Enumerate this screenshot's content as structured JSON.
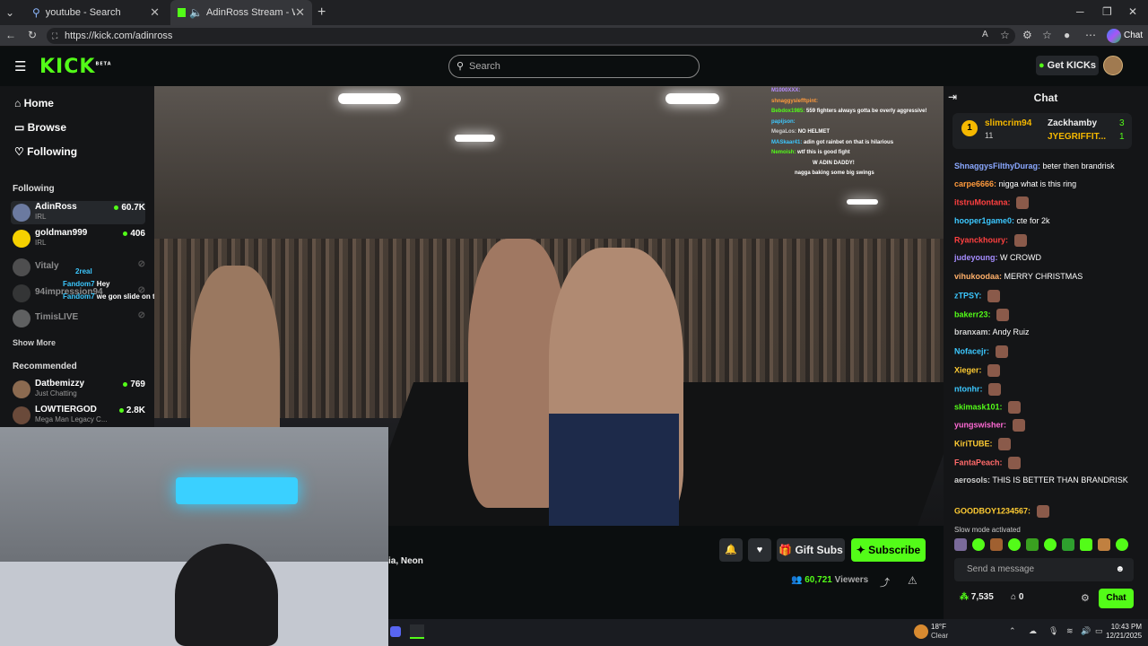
{
  "tabs": [
    {
      "title": "youtube - Search"
    },
    {
      "title": "AdinRoss Stream - Watch Live"
    }
  ],
  "address": {
    "url": "https://kick.com/adinross"
  },
  "browser": {
    "chat_label": "Chat"
  },
  "header": {
    "logo": "KICK",
    "beta": "BETA",
    "search_placeholder": "Search",
    "get_kicks": "Get KICKs"
  },
  "sidebar": {
    "nav": [
      {
        "label": "Home"
      },
      {
        "label": "Browse"
      },
      {
        "label": "Following"
      }
    ],
    "following_title": "Following",
    "following": [
      {
        "name": "AdinRoss",
        "category": "IRL",
        "viewers": "60.7K",
        "live": true
      },
      {
        "name": "goldman999",
        "category": "IRL",
        "viewers": "406",
        "live": true
      },
      {
        "name": "Vitaly",
        "category": "",
        "viewers": "",
        "live": false
      },
      {
        "name": "94impression94",
        "category": "",
        "viewers": "",
        "live": false
      },
      {
        "name": "TimisLIVE",
        "category": "",
        "viewers": "",
        "live": false
      }
    ],
    "show_more": "Show More",
    "recommended_title": "Recommended",
    "recommended": [
      {
        "name": "Datbemizzy",
        "category": "Just Chatting",
        "viewers": "769"
      },
      {
        "name": "LOWTIERGOD",
        "category": "Mega Man Legacy C...",
        "viewers": "2.8K"
      }
    ]
  },
  "overlay_chat": [
    {
      "user": "2real",
      "text": ""
    },
    {
      "user": "Fandom7",
      "text": "Hey"
    },
    {
      "user": "Fandom7",
      "text": "we gon slide on that fat monk LouiBear"
    }
  ],
  "video_chat": [
    {
      "user": "M1000XXX:",
      "text": ""
    },
    {
      "user": "shnaggyslefftpint:",
      "text": ""
    },
    {
      "user": "Bebdox1985:",
      "text": "559 fighters always gotta be overly aggressive!"
    },
    {
      "user": "papijson:",
      "text": ""
    },
    {
      "user": "MegaLos:",
      "text": "NO HELMET"
    },
    {
      "user": "MASkaar41:",
      "text": "adin got rainbet on that is hilarious"
    },
    {
      "user": "Nemoish:",
      "text": "wtf this is good fight"
    },
    {
      "user": "",
      "text": "W ADIN DADDY!"
    },
    {
      "user": "",
      "text": "nagga baking some big swings"
    }
  ],
  "stream": {
    "title_fragment": "ia, Neon",
    "gift_subs": "Gift Subs",
    "subscribe": "Subscribe",
    "viewers": "60,721",
    "viewers_label": "Viewers"
  },
  "chat": {
    "title": "Chat",
    "top_gifters": [
      {
        "rank": "1",
        "name": "slimcrim94",
        "count": "11"
      },
      {
        "name": "Zackhamby",
        "count": "3"
      },
      {
        "name": "JYEGRIFFIT...",
        "count": "1"
      }
    ],
    "messages": [
      {
        "user": "ShnaggysFilthyDurag:",
        "text": "beter then brandrisk",
        "color": "#8aa8ff"
      },
      {
        "user": "carpe6666:",
        "text": "nigga what is this ring",
        "color": "#ff9a3c"
      },
      {
        "user": "itstruMontana:",
        "text": "",
        "color": "#ff4040"
      },
      {
        "user": "hooper1game0:",
        "text": "cte for 2k",
        "color": "#3cc8ff"
      },
      {
        "user": "Ryanckhoury:",
        "text": "",
        "color": "#ff4040"
      },
      {
        "user": "judeyoung:",
        "text": "W CROWD",
        "color": "#a58cff"
      },
      {
        "user": "vihukoodaa:",
        "text": "MERRY CHRISTMAS",
        "color": "#ffb06a"
      },
      {
        "user": "zTPSY:",
        "text": "",
        "color": "#3cc8ff"
      },
      {
        "user": "bakerr23:",
        "text": "",
        "color": "#53fc18"
      },
      {
        "user": "branxam:",
        "text": "Andy Ruiz",
        "color": "#cfcfcf"
      },
      {
        "user": "Nofacejr:",
        "text": "",
        "color": "#3cc8ff"
      },
      {
        "user": "Xieger:",
        "text": "",
        "color": "#ffcc33"
      },
      {
        "user": "ntonhr:",
        "text": "",
        "color": "#3cc8ff"
      },
      {
        "user": "skimask101:",
        "text": "",
        "color": "#53fc18"
      },
      {
        "user": "yungswisher:",
        "text": "",
        "color": "#ff6ad5"
      },
      {
        "user": "KiriTUBE:",
        "text": "",
        "color": "#ffcc33"
      },
      {
        "user": "FantaPeach:",
        "text": "",
        "color": "#ff6a6a"
      },
      {
        "user": "aerosols:",
        "text": "THIS IS BETTER THAN BRANDRISK",
        "color": "#cfcfcf"
      },
      {
        "user": "GOODBOY1234567:",
        "text": "",
        "color": "#ffcc33"
      }
    ],
    "slow_mode": "Slow mode activated",
    "send_placeholder": "Send a message",
    "points": "7,535",
    "store": "0",
    "chat_button": "Chat"
  },
  "taskbar": {
    "temp": "18°F",
    "weather": "Clear",
    "time": "10:43 PM",
    "date": "12/21/2025"
  },
  "colors": {
    "kick_green": "#53fc18",
    "bg": "#0b0e0f",
    "panel": "#141517"
  }
}
